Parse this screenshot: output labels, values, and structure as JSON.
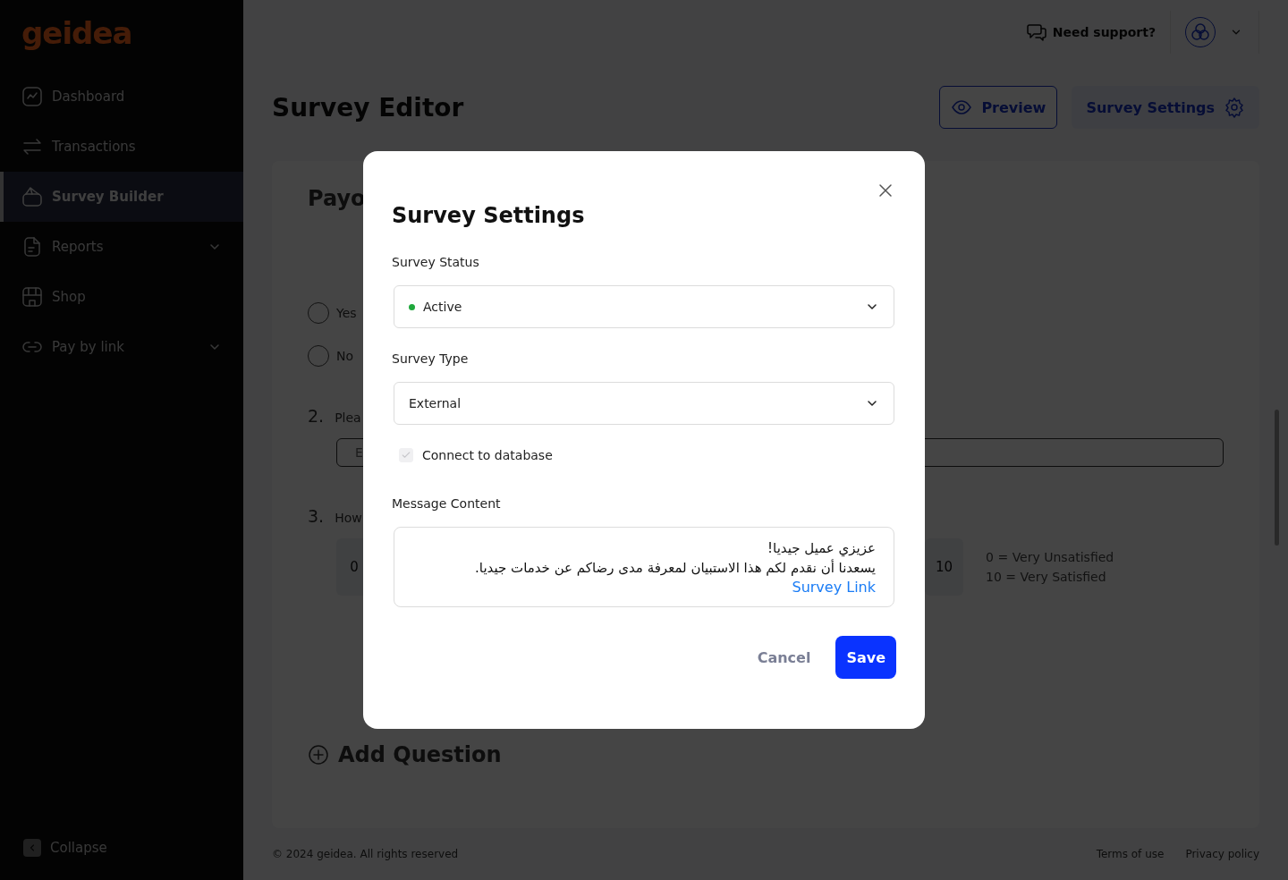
{
  "sidebar": {
    "logo": "geidea",
    "items": [
      {
        "label": "Dashboard",
        "selected": false,
        "has_submenu": false
      },
      {
        "label": "Transactions",
        "selected": false,
        "has_submenu": false
      },
      {
        "label": "Survey Builder",
        "selected": true,
        "has_submenu": false
      },
      {
        "label": "Reports",
        "selected": false,
        "has_submenu": true
      },
      {
        "label": "Shop",
        "selected": false,
        "has_submenu": false
      },
      {
        "label": "Pay by link",
        "selected": false,
        "has_submenu": true
      }
    ],
    "collapse": "Collapse"
  },
  "header": {
    "support": "Need support?"
  },
  "page": {
    "title": "Survey Editor",
    "actions": [
      {
        "label": "Preview",
        "kind": "outline"
      },
      {
        "label": "Survey Settings",
        "kind": "soft"
      }
    ]
  },
  "editor": {
    "heading": "Payo",
    "questions": [
      {
        "kind": "choice",
        "options": [
          {
            "label": "Yes",
            "selected": false
          },
          {
            "label": "No",
            "selected": false
          }
        ]
      },
      {
        "kind": "text",
        "number": "2.",
        "text": "Plea",
        "placeholder": "E"
      },
      {
        "kind": "rating",
        "number": "3.",
        "text": "How",
        "scale_start": "0",
        "scale_end": "10",
        "legend": [
          "0 = Very Unsatisfied",
          "10 = Very Satisfied"
        ]
      }
    ],
    "add_question": "Add Question"
  },
  "footer": {
    "copyright": "© 2024 geidea. All rights reserved",
    "links": [
      "Terms of use",
      "Privacy policy"
    ]
  },
  "modal": {
    "title": "Survey Settings",
    "fields": [
      {
        "kind": "select",
        "label": "Survey Status",
        "value": "Active",
        "color": "#1fa83c"
      },
      {
        "kind": "select",
        "label": "Survey Type",
        "value": "External"
      },
      {
        "kind": "checkbox",
        "label": "Connect to database",
        "checked": true,
        "disabled": true
      },
      {
        "kind": "message",
        "label": "Message Content",
        "lines": [
          "عزيزي عميل جيديا!",
          "يسعدنا أن نقدم لكم هذا الاستبيان لمعرفة مدى رضاكم عن خدمات جيديا."
        ],
        "link": "Survey Link"
      }
    ],
    "buttons": [
      {
        "label": "Cancel",
        "kind": "text"
      },
      {
        "label": "Save",
        "kind": "primary"
      }
    ]
  }
}
